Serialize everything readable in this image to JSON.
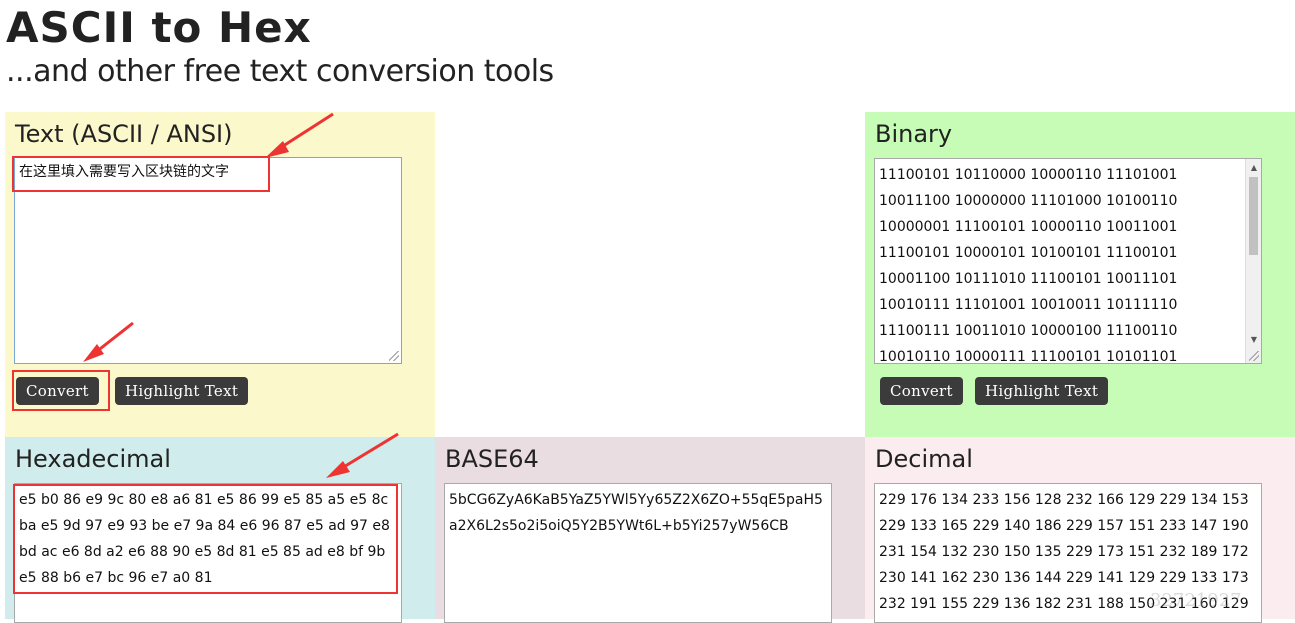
{
  "header": {
    "title": "ASCII to Hex",
    "subtitle": "...and other free text conversion tools"
  },
  "text_panel": {
    "heading": "Text (ASCII / ANSI)",
    "input_value": "在这里填入需要写入区块链的文字",
    "convert_label": "Convert",
    "highlight_label": "Highlight Text"
  },
  "binary_panel": {
    "heading": "Binary",
    "lines": [
      "11100101 10110000 10000110 11101001",
      "10011100 10000000 11101000 10100110",
      "10000001 11100101 10000110 10011001",
      "11100101 10000101 10100101 11100101",
      "10001100 10111010 11100101 10011101",
      "10010111 11101001 10010011 10111110",
      "11100111 10011010 10000100 11100110",
      "10010110 10000111 11100101 10101101"
    ],
    "convert_label": "Convert",
    "highlight_label": "Highlight Text"
  },
  "hex_panel": {
    "heading": "Hexadecimal",
    "lines": [
      "e5 b0 86 e9 9c 80 e8 a6 81 e5 86 99 e5 85 a5 e5 8c",
      "ba e5 9d 97 e9 93 be e7 9a 84 e6 96 87 e5 ad 97 e8",
      "bd ac e6 8d a2 e6 88 90 e5 8d 81 e5 85 ad e8 bf 9b",
      "e5 88 b6 e7 bc 96 e7 a0 81"
    ]
  },
  "base64_panel": {
    "heading": "BASE64",
    "lines": [
      "5bCG6ZyA6KaB5YaZ5YWl5Yy65Z2X6ZO+55qE5paH5",
      "a2X6L2s5o2i5oiQ5Y2B5YWt6L+b5Yi257yW56CB"
    ]
  },
  "decimal_panel": {
    "heading": "Decimal",
    "lines": [
      "229 176 134 233 156 128 232 166 129 229 134 153",
      "229 133 165 229 140 186 229 157 151 233 147 190",
      "231 154 132 230 150 135 229 173 151 232 189 172",
      "230 141 162 230 136 144 229 141 129 229 133 173",
      "232 191 155 229 136 182 231 188 150 231 160 129"
    ]
  },
  "watermark": "32721927",
  "annotation_color": "#e33333"
}
